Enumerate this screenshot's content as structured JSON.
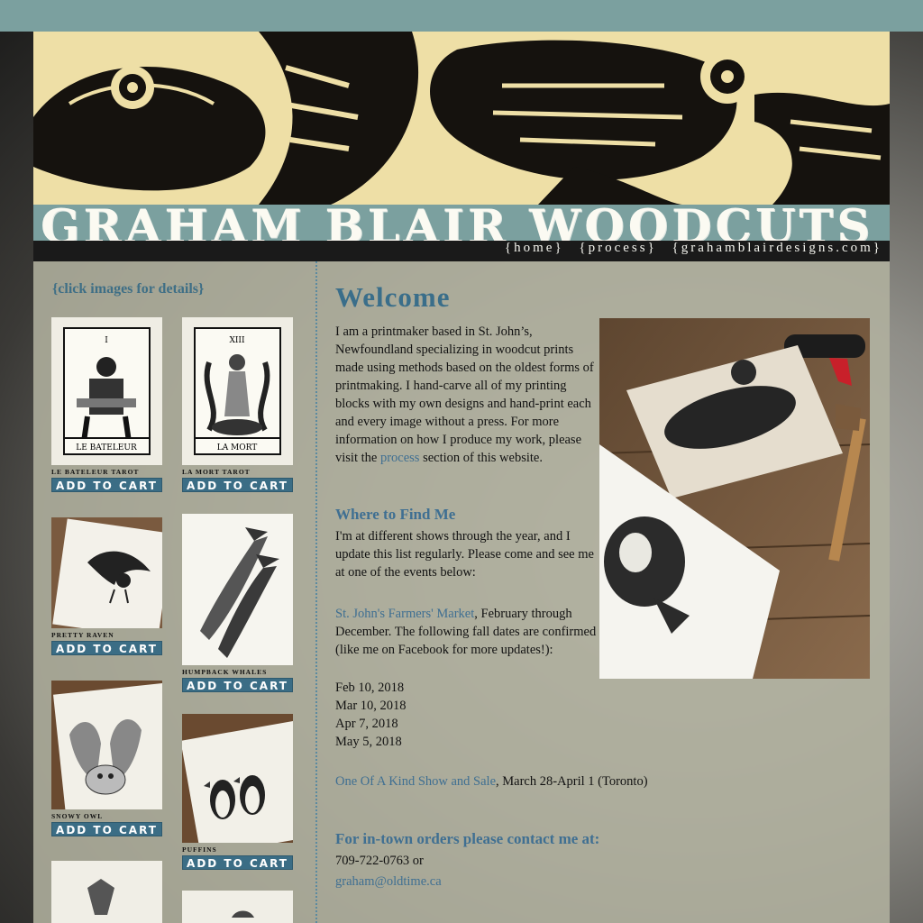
{
  "site": {
    "title": "GRAHAM BLAIR WOODCUTS",
    "nav": [
      "{home}",
      "{process}",
      "{grahamblairdesigns.com}"
    ]
  },
  "sidebar": {
    "hint": "{click images for details}",
    "products": [
      {
        "name": "LE BATELEUR TAROT",
        "card_label": "LE BATELEUR",
        "card_number": "I",
        "button": "ADD TO CART"
      },
      {
        "name": "LA MORT TAROT",
        "card_label": "LA MORT",
        "card_number": "XIII",
        "button": "ADD TO CART"
      },
      {
        "name": "PRETTY RAVEN",
        "button": "ADD TO CART"
      },
      {
        "name": "HUMPBACK WHALES",
        "button": "ADD TO CART"
      },
      {
        "name": "SNOWY OWL",
        "button": "ADD TO CART"
      },
      {
        "name": "PUFFINS",
        "button": "ADD TO CART"
      }
    ]
  },
  "main": {
    "welcome_heading": "Welcome",
    "intro_text": "I am a printmaker based in St. John’s, Newfoundland specializing in woodcut prints made using methods based on the oldest forms of printmaking. I hand-carve all of my printing blocks with my own designs and hand-print each and every image without a press. For more information on how I produce my work, please visit the",
    "intro_link": "process",
    "intro_end": "section of this website.",
    "find_heading": "Where to Find Me",
    "find_text": "I'm at different shows through the year, and I update this list regularly. Please come and see me at one of the events below:",
    "market_link": "St. John's Farmers' Market",
    "market_text": ", February through December. The following fall dates are confirmed (like me on Facebook for more updates!):",
    "dates": [
      "Feb 10, 2018",
      "Mar 10, 2018",
      "Apr 7, 2018",
      "May 5, 2018"
    ],
    "show_link": "One Of A Kind Show and Sale",
    "show_text": ", March 28-April 1 (Toronto)",
    "contact_heading": "For in-town orders please contact me at:",
    "phone": "709-722-0763 or",
    "email": "graham@oldtime.ca"
  }
}
